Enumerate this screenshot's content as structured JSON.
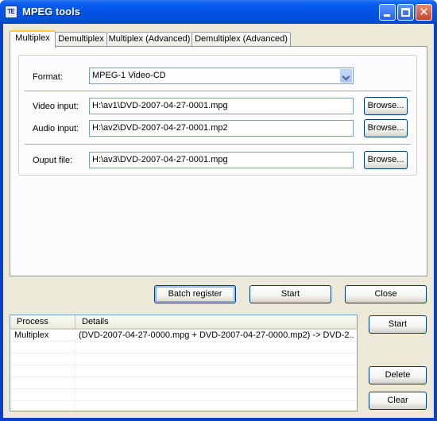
{
  "window": {
    "title": "MPEG tools",
    "icon": "mpeg-tools-app-icon",
    "icon_text": "TE"
  },
  "tabs": [
    "Multiplex",
    "Demultiplex",
    "Multiplex (Advanced)",
    "Demultiplex (Advanced)"
  ],
  "form": {
    "format_label": "Format:",
    "format_label_hotkey": "m",
    "format_value": "MPEG-1 Video-CD",
    "video_label": "Video input:",
    "video_value": "H:\\av1\\DVD-2007-04-27-0001.mpg",
    "audio_label": "Audio input:",
    "audio_value": "H:\\av2\\DVD-2007-04-27-0001.mp2",
    "output_label": "Ouput file:",
    "output_value": "H:\\av3\\DVD-2007-04-27-0001.mpg",
    "browse_label": "Browse..."
  },
  "actions": {
    "batch_register": "Batch register",
    "start": "Start",
    "close": "Close"
  },
  "batch": {
    "columns": [
      "Process",
      "Details"
    ],
    "rows": [
      {
        "process": "Multiplex",
        "details": "(DVD-2007-04-27-0000.mpg + DVD-2007-04-27-0000.mp2) -> DVD-2..."
      }
    ],
    "start": "Start",
    "delete": "Delete",
    "clear": "Clear"
  },
  "colors": {
    "titlebar": "#0554e6",
    "client_bg": "#ece9d8",
    "active_tab_accent": "#ffc83c",
    "button_border": "#003c74"
  }
}
